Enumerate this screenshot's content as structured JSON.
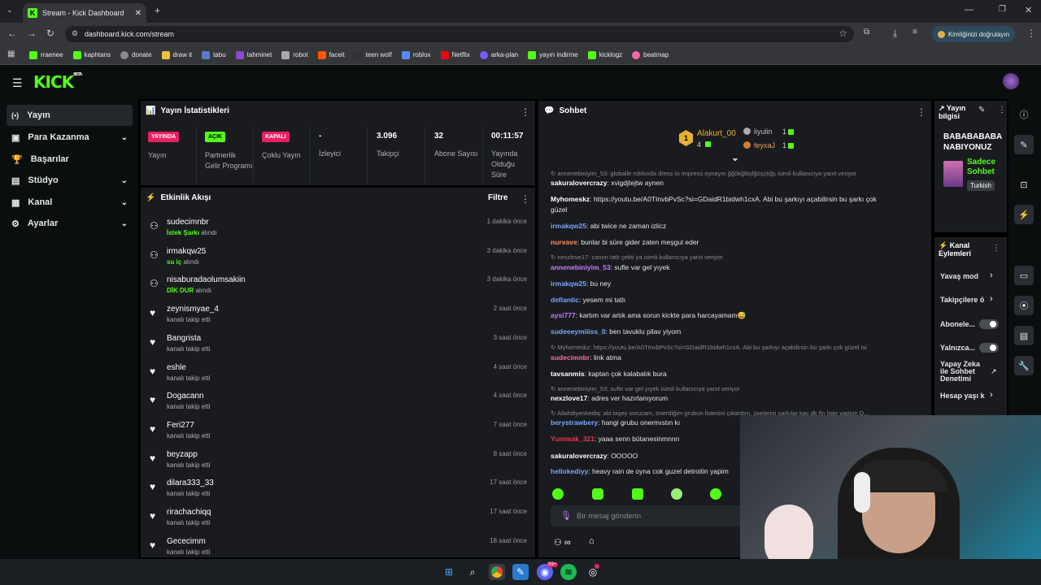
{
  "browser": {
    "tab_title": "Stream - Kick Dashboard",
    "url": "dashboard.kick.com/stream",
    "identity_button": "Kimliğinizi doğrulayın",
    "bookmarks": [
      "rraenee",
      "kaphtans",
      "donate",
      "draw it",
      "tabu",
      "tahminet",
      "robot",
      "faceit",
      "teen wolf",
      "roblox",
      "Netflix",
      "arka-plan",
      "yayın indirme",
      "kicklogz",
      "beatmap"
    ]
  },
  "app": {
    "logo": "KICK",
    "logo_beta": "BETA"
  },
  "sidebar": {
    "items": [
      {
        "label": "Yayın",
        "active": true
      },
      {
        "label": "Para Kazanma",
        "chevron": true
      },
      {
        "label": "Başarılar"
      },
      {
        "label": "Stüdyo",
        "chevron": true
      },
      {
        "label": "Kanal",
        "chevron": true
      },
      {
        "label": "Ayarlar",
        "chevron": true
      }
    ]
  },
  "stats": {
    "title": "Yayın İstatistikleri",
    "cells": [
      {
        "badge": "YAYINDA",
        "badge_color": "#e91e63",
        "label": "Yayın"
      },
      {
        "badge": "AÇIK",
        "badge_color": "#53fc18",
        "label": "Partnerlik Gelir Programı"
      },
      {
        "badge": "KAPALI",
        "badge_color": "#e91e63",
        "label": "Çoklu Yayın"
      },
      {
        "value": "-",
        "label": "İzleyici"
      },
      {
        "value": "3.096",
        "label": "Takipçi"
      },
      {
        "value": "32",
        "label": "Abone Sayısı"
      },
      {
        "value": "00:11:57",
        "label": "Yayında Olduğu Süre"
      }
    ]
  },
  "feed": {
    "title": "Etkinlik Akışı",
    "filter": "Filtre",
    "events": [
      {
        "name": "sudecimnbr",
        "highlight": "İstek Şarkı",
        "action": " alındı",
        "time": "1 dakika önce",
        "icon": "reward"
      },
      {
        "name": "irmakqw25",
        "highlight": "su iç",
        "action": " alındı",
        "time": "3 dakika önce",
        "icon": "reward"
      },
      {
        "name": "nisaburadaolumsakiin",
        "highlight": "DİK DUR",
        "action": " alındı",
        "time": "3 dakika önce",
        "icon": "reward"
      },
      {
        "name": "zeynismyae_4",
        "highlight": "",
        "action": "kanalı takip etti",
        "time": "2 saat önce",
        "icon": "heart"
      },
      {
        "name": "Bangrista",
        "highlight": "",
        "action": "kanalı takip etti",
        "time": "3 saat önce",
        "icon": "heart"
      },
      {
        "name": "eshle",
        "highlight": "",
        "action": "kanalı takip etti",
        "time": "4 saat önce",
        "icon": "heart"
      },
      {
        "name": "Dogacann",
        "highlight": "",
        "action": "kanalı takip etti",
        "time": "4 saat önce",
        "icon": "heart"
      },
      {
        "name": "Feri277",
        "highlight": "",
        "action": "kanalı takip etti",
        "time": "7 saat önce",
        "icon": "heart"
      },
      {
        "name": "beyzapp",
        "highlight": "",
        "action": "kanalı takip etti",
        "time": "8 saat önce",
        "icon": "heart"
      },
      {
        "name": "dilara333_33",
        "highlight": "",
        "action": "kanalı takip etti",
        "time": "17 saat önce",
        "icon": "heart"
      },
      {
        "name": "rirachachiqq",
        "highlight": "",
        "action": "kanalı takip etti",
        "time": "17 saat önce",
        "icon": "heart"
      },
      {
        "name": "Gececimm",
        "highlight": "",
        "action": "kanalı takip etti",
        "time": "18 saat önce",
        "icon": "heart"
      }
    ]
  },
  "chat": {
    "title": "Sohbet",
    "leaderboard": [
      {
        "name": "Alakurt_00",
        "count": "4",
        "rank": "1"
      },
      {
        "name": "liyulin",
        "count": "1"
      },
      {
        "name": "feyxaJ",
        "count": "1"
      }
    ],
    "messages": [
      {
        "reply": "annenebiniyim_53: globalle robloxda dress to impress oynayın ğğökğlöşlğöşçkğş isimli kullanıcıya yanıt veriyor"
      },
      {
        "user": "sakuralovercrazy",
        "color": "#ffffff",
        "text": ": xvigdjtejtw aynen"
      },
      {
        "user": "Myhomeskz",
        "color": "#ffffff",
        "text": ": https://youtu.be/A0TInvbPvSc?si=GDaidR1bidwh1cxA. Abi bu şarkıyı açabilirsin bu şarkı çok"
      },
      {
        "text2": "güzel"
      },
      {
        "user": "irmakqw25",
        "color": "#7aa7ff",
        "text": ": abi twice ne zaman izlicz"
      },
      {
        "user": "nurvave",
        "color": "#ff8c5a",
        "text": ": bunlar bi süre gider zaten meşgul eder"
      },
      {
        "reply": "nexzlove17: canım tatlı çekti ya isimli kullanıcıya yanıt veriyor"
      },
      {
        "user": "annenebiniyim_53",
        "color": "#c77dff",
        "text": ": sufle var gel yıyek"
      },
      {
        "user": "irmakqw25",
        "color": "#7aa7ff",
        "text": ": bu ney"
      },
      {
        "user": "deflantic",
        "color": "#7aa7ff",
        "text": ": yesem mi tatlı"
      },
      {
        "user": "aysi777",
        "color": "#c77dff",
        "text": ": kartım var artık ama sorun kickte para harcayamam😅"
      },
      {
        "user": "sudeeeymiiiss_0",
        "color": "#7aa7ff",
        "text": ": ben tavuklu pilav yiyom"
      },
      {
        "reply": "Myhomeskz: https://youtu.be/A0TInvbPvSc?si=GDaidR1bidwh1cxA. Abi bu şarkıyı açabilirsin bu şarkı çok güzel isi"
      },
      {
        "user": "sudecimnbr",
        "color": "#ff6b9d",
        "text": ": link atma"
      },
      {
        "user": "tavsanmis",
        "color": "#ffffff",
        "text": ": kaptan çok kalabalık bura"
      },
      {
        "reply": "annenebiniyim_53: sufle var gel yıyek isimli kullanıcıya yanıt veriyor"
      },
      {
        "user": "nexzlove17",
        "color": "#ffffff",
        "text": ": adres ver hazırlanıyorum"
      },
      {
        "reply": "Allahdiyenkediq: abi bişey sorucam, önerdiğim grubun listesini çıkardım, üyelerini şarkılar kaç dk fln liste yaptım D..."
      },
      {
        "user": "berystrawbery",
        "color": "#7aa7ff",
        "text": ": hangi grubu onermıstın kı"
      },
      {
        "user": "Yummak_321",
        "color": "#e63946",
        "text": ": yaaa senn bütanesinmnnn"
      },
      {
        "user": "sakuralovercrazy",
        "color": "#ffffff",
        "text": ": OOOOO"
      },
      {
        "user": "hellokediyy",
        "color": "#7aa7ff",
        "text": ": heavy rain de oyna cok guzel detroitin yapim"
      }
    ],
    "input_placeholder": "Bir mesaj gönderin"
  },
  "stream_info": {
    "title": "Yayın bilgisi",
    "stream_title": "BABABABABA NABIYONUZ",
    "category": "Sadece Sohbet",
    "language": "Turkish"
  },
  "channel_actions": {
    "title": "Kanal Eylemleri",
    "items": [
      {
        "label": "Yavaş mod",
        "type": "chevron"
      },
      {
        "label": "Takipçilere ö",
        "type": "chevron"
      },
      {
        "label": "Abonele...",
        "type": "toggle"
      },
      {
        "label": "Yalnızca...",
        "type": "toggle"
      },
      {
        "label": "Yapay Zeka ile Sohbet Denetimi",
        "type": "link"
      },
      {
        "label": "Hesap yaşı k",
        "type": "chevron"
      }
    ]
  },
  "taskbar": {
    "badge": "99+"
  }
}
